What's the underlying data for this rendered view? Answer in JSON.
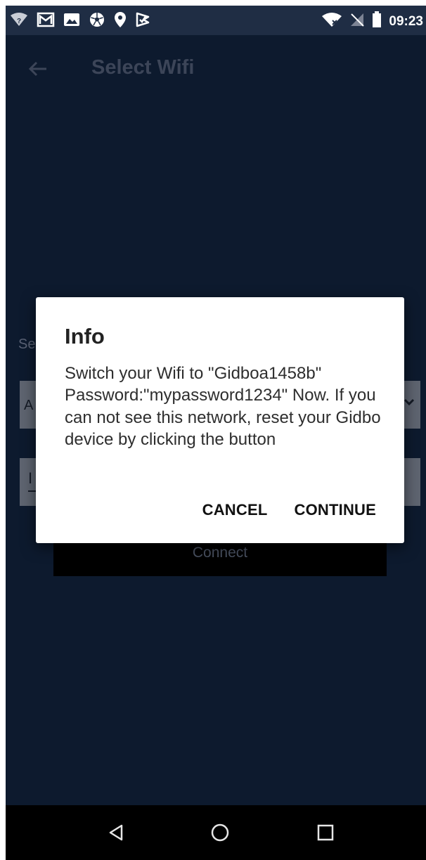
{
  "status_bar": {
    "time": "09:23",
    "left_icons": [
      "wifi-question-icon",
      "gmail-icon",
      "image-icon",
      "soccer-ball-icon",
      "location-pin-icon",
      "check-shield-icon"
    ],
    "right_icons": [
      "wifi-off-icon",
      "no-sim-icon",
      "battery-icon"
    ]
  },
  "appbar": {
    "title": "Select Wifi"
  },
  "background_form": {
    "section_label": "Se",
    "select_value": "A",
    "input_value": "I",
    "connect_label": "Connect"
  },
  "dialog": {
    "title": "Info",
    "message": "Switch your Wifi to \"Gidboa1458b\" Password:\"mypassword1234\" Now. If you can not see this network, reset your Gidbo device by clicking the button",
    "cancel_label": "CANCEL",
    "continue_label": "CONTINUE"
  },
  "colors": {
    "status_bar_bg": "#1f2d44",
    "app_bg": "#0d1a2e",
    "dialog_bg": "#ffffff",
    "nav_bar_bg": "#000000"
  }
}
